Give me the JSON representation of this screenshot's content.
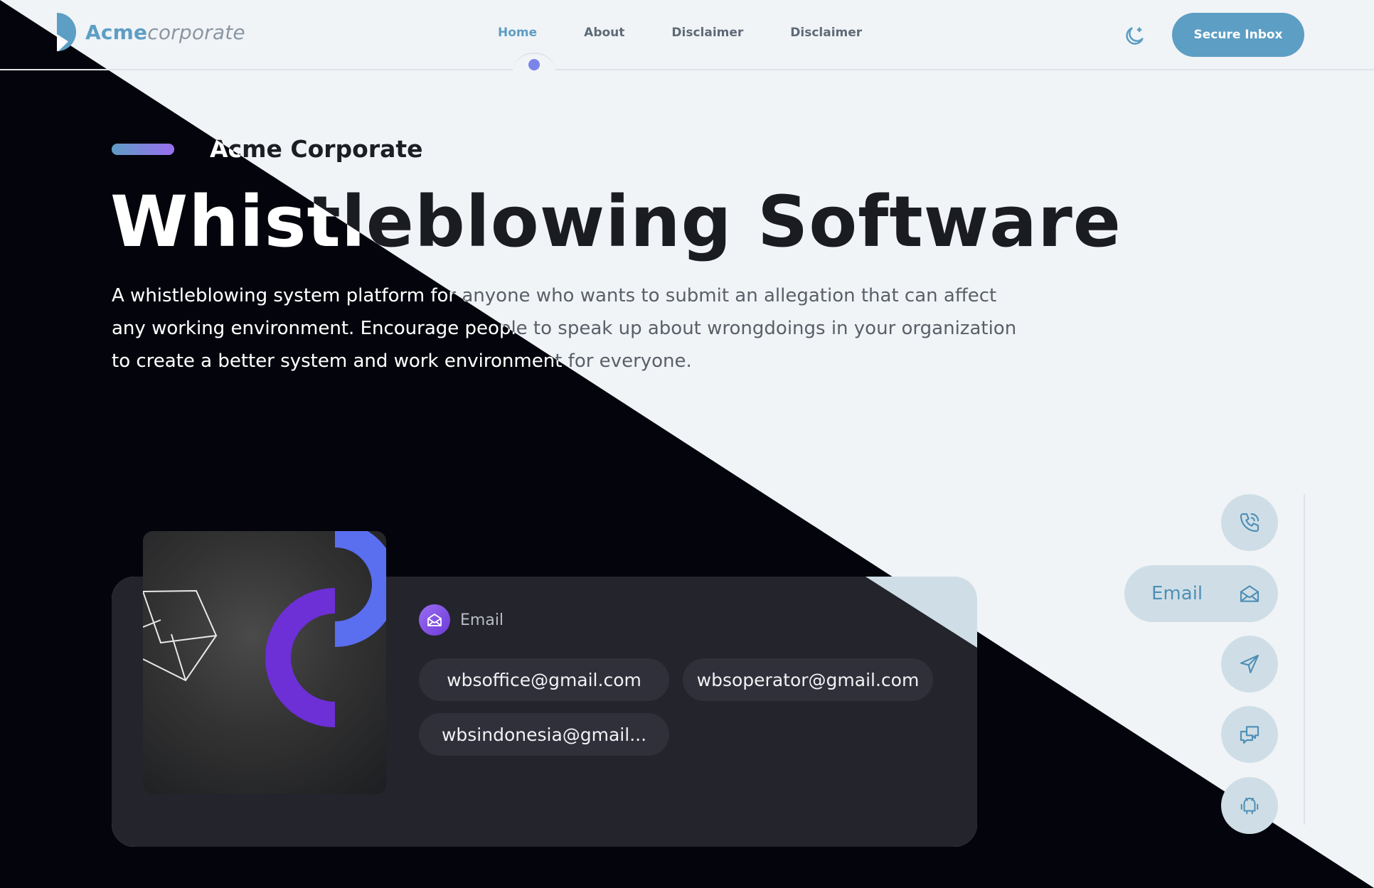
{
  "header": {
    "logo_bold": "Acme",
    "logo_italic": "corporate",
    "nav": [
      "Home",
      "About",
      "Disclaimer",
      "Disclaimer"
    ],
    "cta": "Secure Inbox"
  },
  "hero": {
    "eyebrow": "Acme Corporate",
    "title": "Whistleblowing Software",
    "description": "A whistleblowing system platform for anyone who wants to submit an allegation that can affect any working environment. Encourage people to speak up about wrongdoings in your organization to create a better system and work environment for everyone."
  },
  "card": {
    "label": "Email",
    "emails": [
      "wbsoffice@gmail.com",
      "wbsoperator@gmail.com",
      "wbsindonesia@gmail..."
    ]
  },
  "rail": {
    "items": [
      {
        "icon": "phone-icon"
      },
      {
        "icon": "email-icon",
        "label": "Email"
      },
      {
        "icon": "send-icon"
      },
      {
        "icon": "chat-icon"
      },
      {
        "icon": "android-icon"
      }
    ]
  },
  "colors": {
    "accent": "#5d9ec4",
    "purple": "#6d3ad9",
    "blue_arc": "#5a6ef0",
    "dark_bg": "#04050c",
    "light_bg": "#f1f4f7"
  }
}
